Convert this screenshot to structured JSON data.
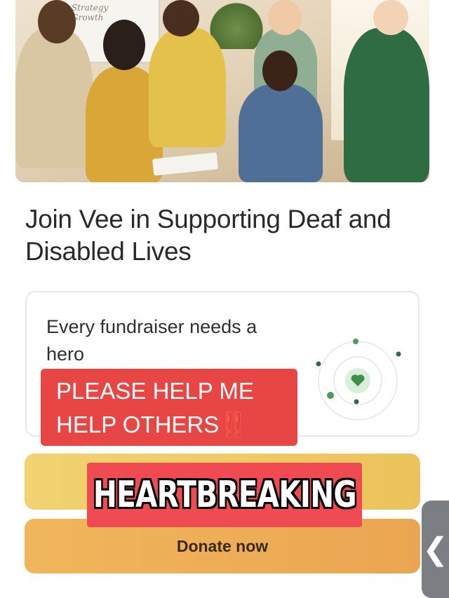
{
  "hero": {
    "board_text": "Strategy\nGrowth"
  },
  "page": {
    "title": "Join Vee in Supporting Deaf and Disabled Lives"
  },
  "card": {
    "text": "Every fundraiser needs a hero",
    "icon": "heart-orbit-icon",
    "accent": "#4f9a5a"
  },
  "overlays": {
    "red_caption": "PLEASE HELP ME HELP OTHERS",
    "red_caption_emoji": "‼️",
    "heart_caption": "HEARTBREAKING"
  },
  "buttons": {
    "share_label": "",
    "donate_label": "Donate now"
  },
  "side_tab": {
    "icon": "chevron-left-icon"
  },
  "colors": {
    "yellow_button": "#efca66",
    "orange_button": "#eeae57",
    "overlay_red": "#e84545"
  }
}
